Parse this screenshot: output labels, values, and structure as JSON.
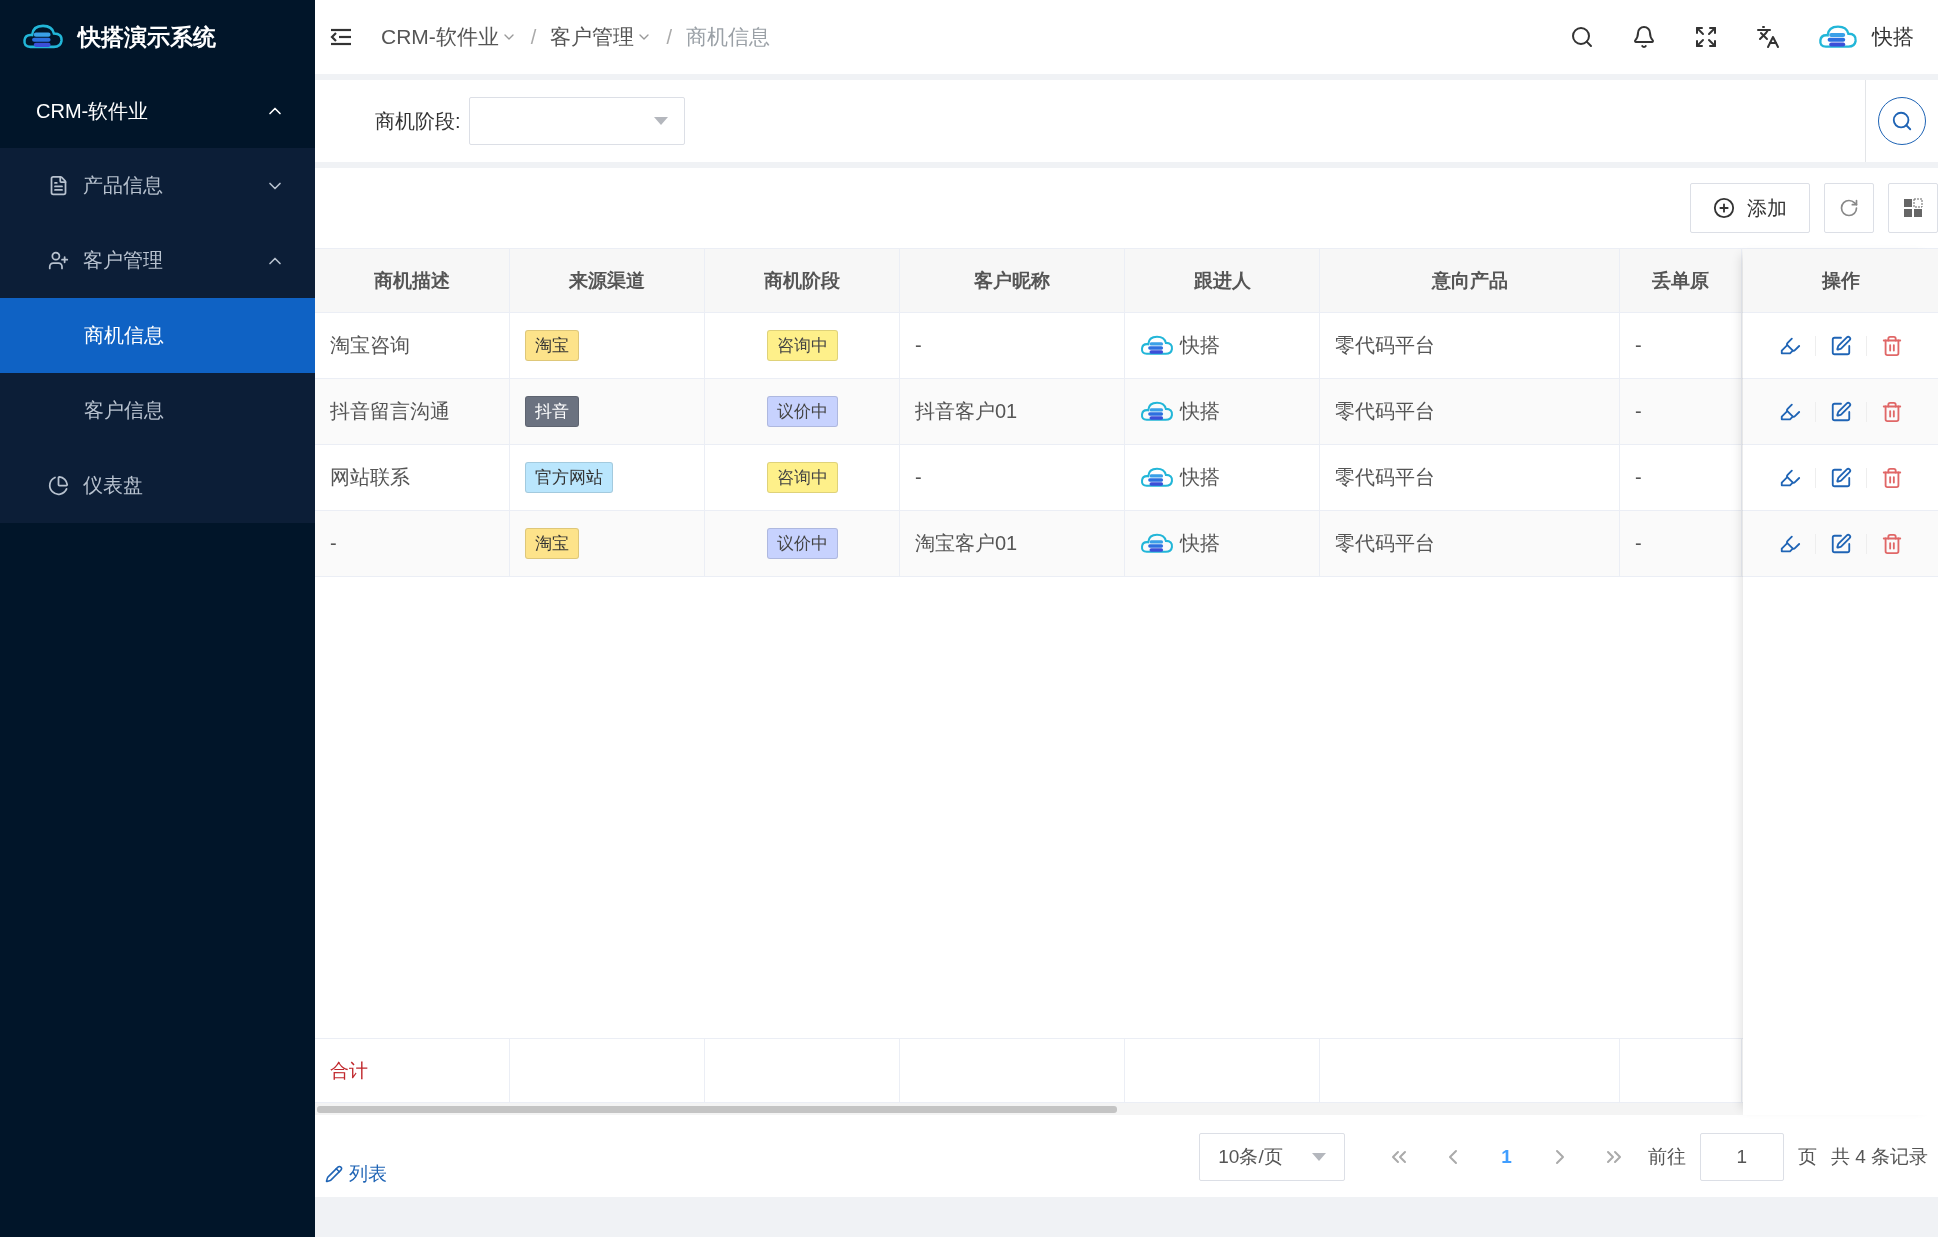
{
  "app": {
    "title": "快搭演示系统"
  },
  "sidebar": {
    "items": [
      {
        "label": "CRM-软件业",
        "expanded": true,
        "children": [
          {
            "label": "产品信息",
            "expanded": false
          },
          {
            "label": "客户管理",
            "expanded": true,
            "children": [
              {
                "label": "商机信息",
                "selected": true
              },
              {
                "label": "客户信息",
                "selected": false
              }
            ]
          },
          {
            "label": "仪表盘"
          }
        ]
      }
    ]
  },
  "header": {
    "separator": "/",
    "breadcrumb": [
      {
        "label": "CRM-软件业",
        "dropdown": true
      },
      {
        "label": "客户管理",
        "dropdown": true
      },
      {
        "label": "商机信息",
        "dropdown": false
      }
    ],
    "user": "快搭"
  },
  "filter": {
    "label": "商机阶段:"
  },
  "toolbar": {
    "add_button": "添加"
  },
  "table": {
    "columns": [
      "商机描述",
      "来源渠道",
      "商机阶段",
      "客户昵称",
      "跟进人",
      "意向产品",
      "丢单原",
      "操作"
    ],
    "rows": [
      {
        "description": "淘宝咨询",
        "source": {
          "text": "淘宝",
          "color": "#fde38a"
        },
        "stage": {
          "text": "咨询中",
          "color": "#fef08a"
        },
        "customer": "-",
        "follower": "快搭",
        "product": "零代码平台",
        "loss_reason": "-"
      },
      {
        "description": "抖音留言沟通",
        "source": {
          "text": "抖音",
          "color": "#6b7280"
        },
        "stage": {
          "text": "议价中",
          "color": "#c7d2fe"
        },
        "customer": "抖音客户01",
        "follower": "快搭",
        "product": "零代码平台",
        "loss_reason": "-"
      },
      {
        "description": "网站联系",
        "source": {
          "text": "官方网站",
          "color": "#bae6fd"
        },
        "stage": {
          "text": "咨询中",
          "color": "#fef08a"
        },
        "customer": "-",
        "follower": "快搭",
        "product": "零代码平台",
        "loss_reason": "-"
      },
      {
        "description": "-",
        "source": {
          "text": "淘宝",
          "color": "#fde38a"
        },
        "stage": {
          "text": "议价中",
          "color": "#c7d2fe"
        },
        "customer": "淘宝客户01",
        "follower": "快搭",
        "product": "零代码平台",
        "loss_reason": "-"
      }
    ],
    "summary_label": "合计"
  },
  "footer": {
    "link": "列表"
  },
  "pagination": {
    "page_size": "10条/页",
    "pages": [
      {
        "label": "1",
        "selected": true
      }
    ],
    "goto_label": "前往",
    "goto_value": "1",
    "page_unit": "页",
    "total": "共 4 条记录"
  }
}
